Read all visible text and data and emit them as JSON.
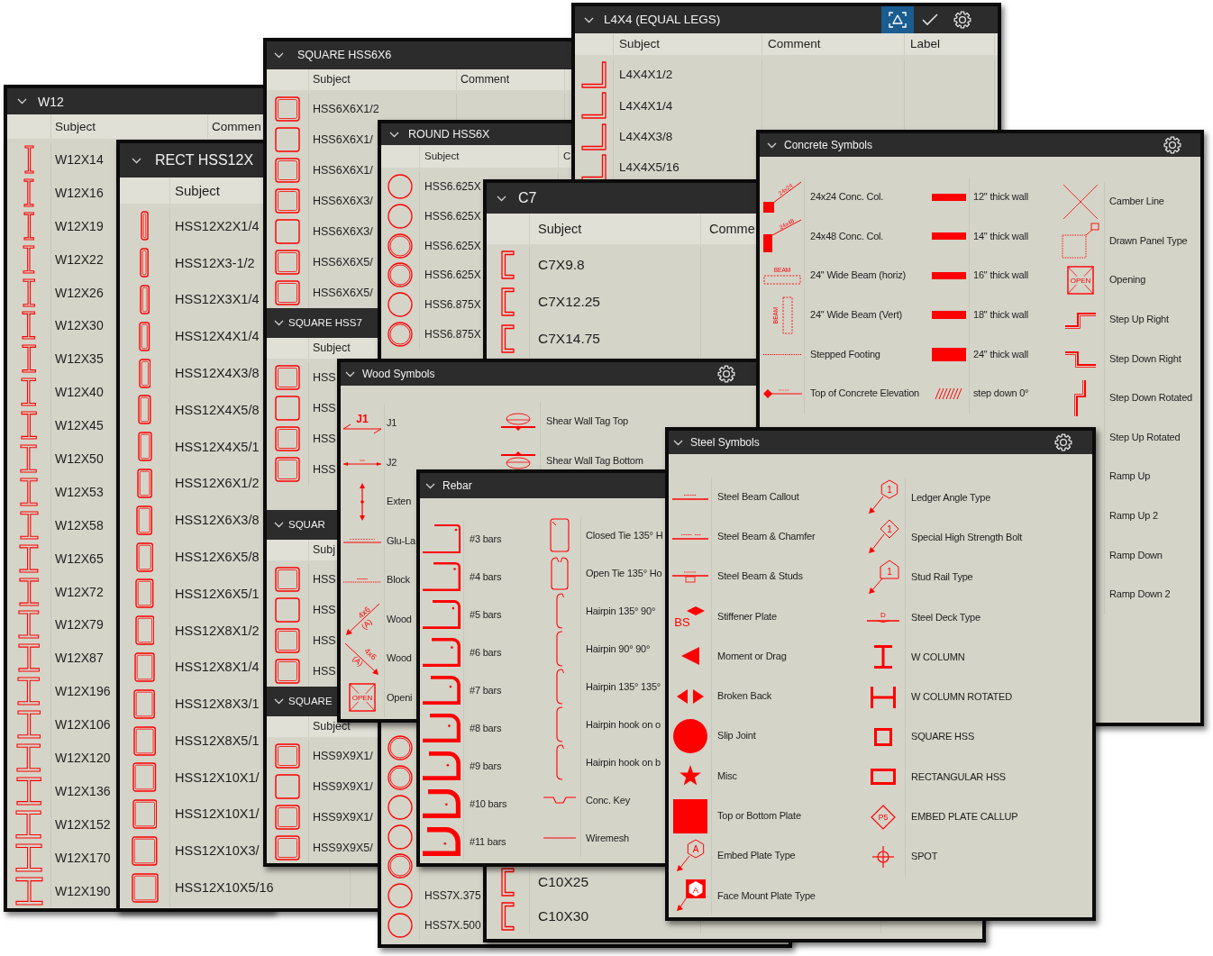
{
  "panels": [
    {
      "kind": "wtable",
      "groups": [
        {
          "title": "W12",
          "columns": [
            "Subject",
            "Commen"
          ],
          "rows": [
            "W12X14",
            "W12X16",
            "W12X19",
            "W12X22",
            "W12X26",
            "W12X30",
            "W12X35",
            "W12X40",
            "W12X45",
            "W12X50",
            "W12X53",
            "W12X58",
            "W12X65",
            "W12X72",
            "W12X79",
            "W12X87",
            "W12X196",
            "W12X106",
            "W12X120",
            "W12X136",
            "W12X152",
            "W12X170",
            "W12X190"
          ]
        }
      ]
    },
    {
      "kind": "recttable",
      "groups": [
        {
          "title": "RECT HSS12X",
          "columns": [
            "Subject"
          ],
          "rows": [
            "HSS12X2X1/4",
            "HSS12X3-1/2",
            "HSS12X3X1/4",
            "HSS12X4X1/4",
            "HSS12X4X3/8",
            "HSS12X4X5/8",
            "HSS12X4X5/1",
            "HSS12X6X1/2",
            "HSS12X6X3/8",
            "HSS12X6X5/8",
            "HSS12X6X5/1",
            "HSS12X8X1/2",
            "HSS12X8X1/4",
            "HSS12X8X3/1",
            "HSS12X8X5/1",
            "HSS12X10X1/",
            "HSS12X10X1/",
            "HSS12X10X3/",
            "HSS12X10X5/16"
          ]
        }
      ]
    },
    {
      "kind": "squaretable",
      "groups": [
        {
          "title": "SQUARE HSS6X6",
          "columns": [
            "Subject",
            "Comment"
          ],
          "rows": [
            "HSS6X6X1/2",
            "HSS6X6X1/",
            "HSS6X6X1/",
            "HSS6X6X3/",
            "HSS6X6X3/",
            "HSS6X6X5/",
            "HSS6X6X5/"
          ]
        },
        {
          "title": "SQUARE HSS7",
          "columns": [
            "Subject"
          ],
          "rows": [
            "HSS",
            "HSS",
            "HSS",
            "HSS"
          ]
        },
        {
          "title": "SQUAR",
          "columns": [
            "Subj"
          ],
          "rows": [
            "HSS",
            "HSS",
            "HSS",
            "HSS"
          ]
        },
        {
          "title": "SQUARE",
          "columns": [
            "Subject"
          ],
          "rows": [
            "HSS9X9X1/",
            "HSS9X9X1/",
            "HSS9X9X1/",
            "HSS9X9X5/"
          ]
        }
      ]
    },
    {
      "kind": "roundtable",
      "groups": [
        {
          "title": "ROUND HSS6X",
          "columns": [
            "Subject",
            "C"
          ],
          "rows": [
            "HSS6.625X",
            "HSS6.625X",
            "HSS6.625X",
            "HSS6.625X",
            "HSS6.875X",
            "HSS6.875X"
          ],
          "bottom_rows": [
            "HSS7X.375",
            "HSS7X.500"
          ]
        }
      ]
    },
    {
      "kind": "angletable",
      "tools": [
        {
          "kind": "fit",
          "selected": true
        },
        {
          "kind": "check",
          "selected": false
        },
        {
          "kind": "settings",
          "selected": false
        }
      ],
      "groups": [
        {
          "title": "L4X4 (EQUAL LEGS)",
          "columns": [
            "Subject",
            "Comment",
            "Label"
          ],
          "rows": [
            "L4X4X1/2",
            "L4X4X1/4",
            "L4X4X3/8",
            "L4X4X5/16"
          ]
        }
      ]
    },
    {
      "kind": "channeltable",
      "groups": [
        {
          "title": "C7",
          "columns": [
            "Subject",
            "Comme"
          ],
          "rows": [
            "C7X9.8",
            "C7X12.25",
            "C7X14.75"
          ],
          "bottom_rows": [
            "C10X25",
            "C10X30"
          ]
        }
      ]
    },
    {
      "kind": "woodpalette",
      "title": "Wood Symbols",
      "tools": [
        {
          "kind": "settings",
          "selected": false
        }
      ],
      "columns": [
        [
          {
            "label": "J1",
            "tags": [
              "J1"
            ]
          },
          {
            "label": "J2"
          },
          {
            "label": "Exten"
          },
          {
            "label": "Glu-La"
          },
          {
            "label": "Block"
          },
          {
            "label": "Wood",
            "tags": [
              "4x6",
              "(A)"
            ]
          },
          {
            "label": "Wood",
            "tags": [
              "4x6",
              "(A)"
            ]
          },
          {
            "label": "Openi",
            "tags": [
              "OPEN"
            ]
          }
        ],
        [
          {
            "label": "Shear Wall Tag Top"
          },
          {
            "label": "Shear Wall Tag Bottom"
          }
        ]
      ]
    },
    {
      "kind": "concretepalette",
      "title": "Concrete Symbols",
      "tools": [
        {
          "kind": "settings",
          "selected": false
        }
      ],
      "columns": [
        [
          {
            "label": "24x24 Conc. Col.",
            "tags": [
              "24x24"
            ]
          },
          {
            "label": "24x48 Conc. Col.",
            "tags": [
              "24x48"
            ]
          },
          {
            "label": "24\" Wide Beam (horiz)",
            "tags": [
              "BEAM"
            ]
          },
          {
            "label": "24\" Wide Beam (Vert)",
            "tags": [
              "BEAM"
            ]
          },
          {
            "label": "Stepped Footing"
          },
          {
            "label": "Top of Concrete Elevation"
          }
        ],
        [
          {
            "label": "12\" thick wall"
          },
          {
            "label": "14\" thick wall"
          },
          {
            "label": "16\" thick wall"
          },
          {
            "label": "18\" thick wall"
          },
          {
            "label": "24\" thick wall"
          },
          {
            "label": "step down 0°"
          }
        ],
        [
          {
            "label": "Camber Line"
          },
          {
            "label": "Drawn Panel Type"
          },
          {
            "label": "Opening",
            "tags": [
              "OPEN"
            ]
          },
          {
            "label": "Step Up Right"
          },
          {
            "label": "Step Down Right"
          },
          {
            "label": "Step Down Rotated"
          },
          {
            "label": "Step Up Rotated"
          },
          {
            "label": "Ramp Up"
          },
          {
            "label": "Ramp Up 2"
          },
          {
            "label": "Ramp Down"
          },
          {
            "label": "Ramp Down 2"
          }
        ]
      ]
    },
    {
      "kind": "rebarpalette",
      "title": "Rebar",
      "columns": [
        [
          {
            "label": "#3 bars"
          },
          {
            "label": "#4 bars"
          },
          {
            "label": "#5 bars"
          },
          {
            "label": "#6 bars"
          },
          {
            "label": "#7 bars"
          },
          {
            "label": "#8 bars"
          },
          {
            "label": "#9 bars"
          },
          {
            "label": "#10 bars"
          },
          {
            "label": "#11 bars"
          }
        ],
        [
          {
            "label": "Closed Tie 135° H"
          },
          {
            "label": "Open Tie 135° Ho"
          },
          {
            "label": "Hairpin 135° 90°"
          },
          {
            "label": "Hairpin 90° 90°"
          },
          {
            "label": "Hairpin 135° 135°"
          },
          {
            "label": "Hairpin hook on o"
          },
          {
            "label": "Hairpin hook on b"
          },
          {
            "label": "Conc. Key"
          },
          {
            "label": "Wiremesh"
          }
        ]
      ]
    },
    {
      "kind": "steelpalette",
      "title": "Steel Symbols",
      "tools": [
        {
          "kind": "settings",
          "selected": false
        }
      ],
      "columns": [
        [
          {
            "label": "Steel Beam Callout"
          },
          {
            "label": "Steel Beam & Chamfer"
          },
          {
            "label": "Steel Beam & Studs"
          },
          {
            "label": "Stiffener Plate",
            "tags": [
              "BS"
            ]
          },
          {
            "label": "Moment or Drag"
          },
          {
            "label": "Broken Back"
          },
          {
            "label": "Slip Joint"
          },
          {
            "label": "Misc"
          },
          {
            "label": "Top or Bottom Plate"
          },
          {
            "label": "Embed Plate Type",
            "tags": [
              "A"
            ]
          },
          {
            "label": "Face Mount Plate Type",
            "tags": [
              "A"
            ]
          }
        ],
        [
          {
            "label": "Ledger Angle Type",
            "tags": [
              "1"
            ]
          },
          {
            "label": "Special High Strength Bolt",
            "tags": [
              "1"
            ]
          },
          {
            "label": "Stud Rail Type",
            "tags": [
              "1"
            ]
          },
          {
            "label": "Steel Deck Type",
            "tags": [
              "D"
            ]
          },
          {
            "label": "W COLUMN"
          },
          {
            "label": "W COLUMN ROTATED"
          },
          {
            "label": "SQUARE HSS"
          },
          {
            "label": "RECTANGULAR HSS"
          },
          {
            "label": "EMBED PLATE CALLUP",
            "tags": [
              "P5"
            ]
          },
          {
            "label": "SPOT"
          }
        ]
      ]
    }
  ]
}
